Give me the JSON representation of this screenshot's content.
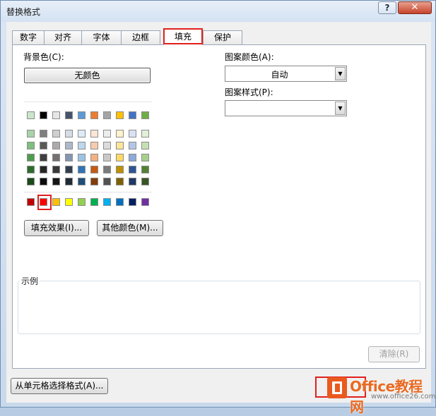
{
  "window": {
    "title": "替换格式",
    "help_label": "?",
    "close_label": "✕"
  },
  "tabs": [
    {
      "label": "数字"
    },
    {
      "label": "对齐"
    },
    {
      "label": "字体"
    },
    {
      "label": "边框"
    },
    {
      "label": "填充",
      "active": true
    },
    {
      "label": "保护"
    }
  ],
  "fill": {
    "background_label": "背景色(C):",
    "no_color_label": "无颜色",
    "fill_effects_label": "填充效果(I)...",
    "more_colors_label": "其他颜色(M)...",
    "pattern_color_label": "图案颜色(A):",
    "pattern_color_value": "自动",
    "pattern_style_label": "图案样式(P):",
    "pattern_style_value": "",
    "sample_label": "示例",
    "clear_label": "清除(R)",
    "selected_color": "#FF0000"
  },
  "palette": {
    "theme_top": [
      "#CCE5CC",
      "#000000",
      "#E6E6E6",
      "#44546A",
      "#5B9BD5",
      "#ED7D31",
      "#A5A5A5",
      "#FFC000",
      "#4472C4",
      "#70AD47"
    ],
    "theme_rows": [
      [
        "#A9D3A9",
        "#7F7F7F",
        "#D0CECE",
        "#D6DCE4",
        "#DEEBF6",
        "#FBE5D5",
        "#EDEDED",
        "#FFF2CC",
        "#D9E2F3",
        "#E2EFD9"
      ],
      [
        "#7EBF7E",
        "#595959",
        "#AEAAAA",
        "#ADB9CA",
        "#BDD7EE",
        "#F7CBAC",
        "#DBDBDB",
        "#FEE599",
        "#B4C6E7",
        "#C5E0B3"
      ],
      [
        "#4F9B4F",
        "#3F3F3F",
        "#757070",
        "#8496B0",
        "#9CC3E5",
        "#F4B183",
        "#C9C9C9",
        "#FFD965",
        "#8EAADB",
        "#A8D08D"
      ],
      [
        "#2D6B2D",
        "#262626",
        "#3A3838",
        "#323F4F",
        "#2E75B5",
        "#C55A11",
        "#7B7B7B",
        "#BF9000",
        "#2F5496",
        "#538135"
      ],
      [
        "#1B4A1B",
        "#0C0C0C",
        "#171616",
        "#222A35",
        "#1F4E79",
        "#833C0B",
        "#525252",
        "#7F6000",
        "#1F3864",
        "#375623"
      ]
    ],
    "standard": [
      "#C00000",
      "#FF0000",
      "#FFC000",
      "#FFFF00",
      "#92D050",
      "#00B050",
      "#00B0F0",
      "#0070C0",
      "#002060",
      "#7030A0"
    ]
  },
  "footer": {
    "choose_from_cell_label": "从单元格选择格式(A)..."
  },
  "watermark": {
    "brand": "Office教程网",
    "url": "www.office26.com"
  }
}
